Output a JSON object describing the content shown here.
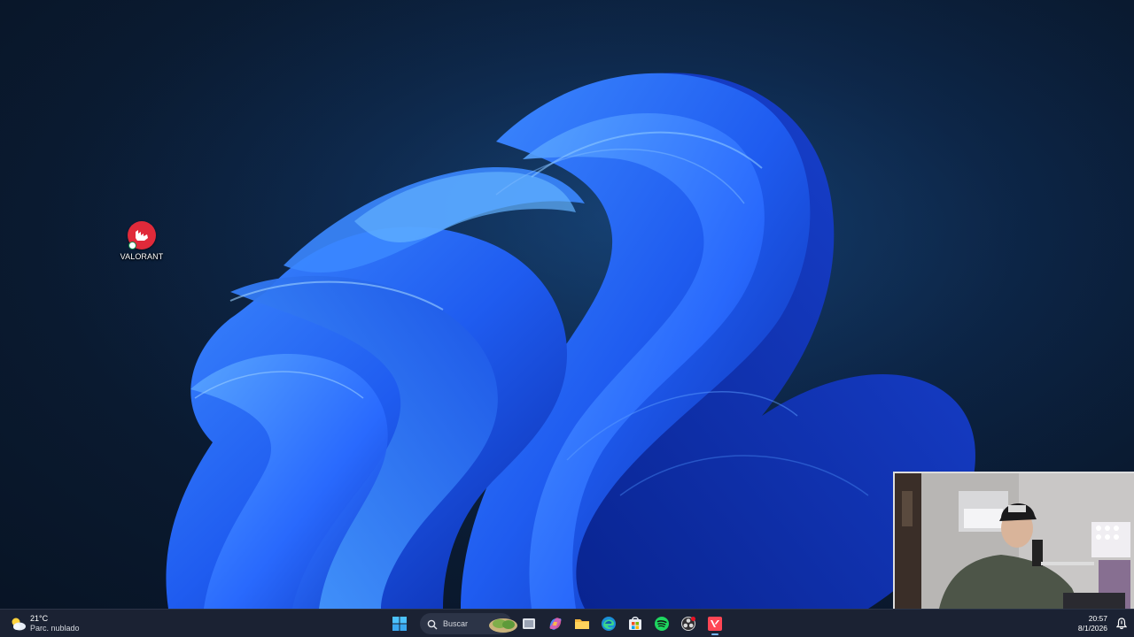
{
  "desktop": {
    "wallpaper": "windows-11-bloom",
    "icons": [
      {
        "label": "VALORANT",
        "icon": "riot-fist-icon",
        "color": "#e02a3a"
      }
    ]
  },
  "webcam_overlay": {
    "content": "streamer-webcam"
  },
  "taskbar": {
    "weather": {
      "temperature": "21°C",
      "condition": "Parc. nublado",
      "icon": "partly-cloudy-icon"
    },
    "start_icon": "windows-start-icon",
    "search": {
      "placeholder": "Buscar"
    },
    "pinned": [
      {
        "name": "task-view",
        "icon": "task-view-icon"
      },
      {
        "name": "copilot",
        "icon": "copilot-icon"
      },
      {
        "name": "file-explorer",
        "icon": "folder-icon"
      },
      {
        "name": "edge",
        "icon": "edge-icon"
      },
      {
        "name": "microsoft-store",
        "icon": "store-icon"
      },
      {
        "name": "spotify",
        "icon": "spotify-icon"
      },
      {
        "name": "obs",
        "icon": "obs-icon"
      },
      {
        "name": "valorant",
        "icon": "valorant-icon",
        "active": true
      }
    ],
    "clock": {
      "time": "20:57",
      "date": "8/1/2026"
    },
    "accent_color": "#7ab8ff",
    "background_color": "#1b2233"
  }
}
